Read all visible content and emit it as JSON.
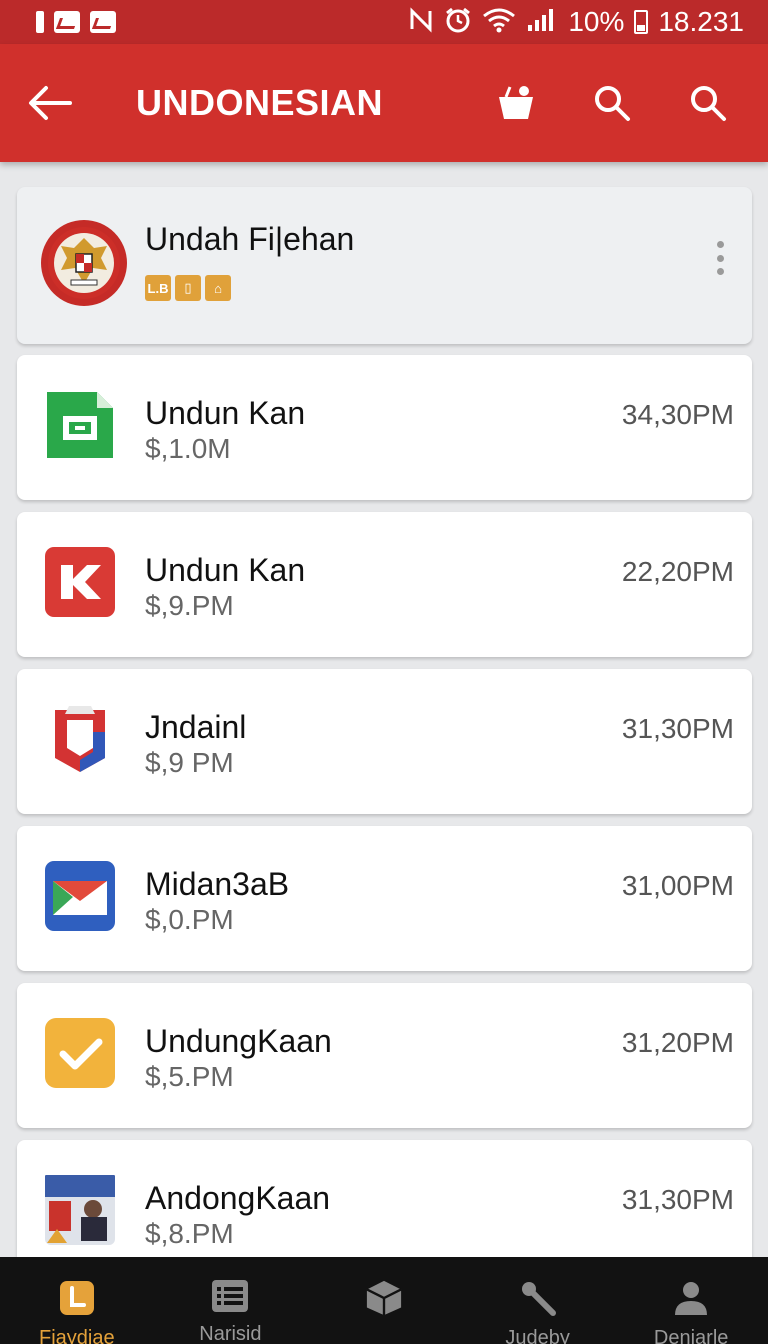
{
  "status_bar": {
    "battery": "10%",
    "time": "18.231"
  },
  "app_bar": {
    "title": "UNDONESIAN"
  },
  "header_card": {
    "title": "Undah Fi|ehan",
    "badges": [
      "L.B",
      "",
      ""
    ]
  },
  "items": [
    {
      "title": "Undun Kan",
      "subtitle": "$,1.0M",
      "time": "34,30PM",
      "icon": "green-document-icon",
      "color": "#2aa84a"
    },
    {
      "title": "Undun Kan",
      "subtitle": "$,9.PM",
      "time": "22,20PM",
      "icon": "red-k-icon",
      "color": "#d93a35"
    },
    {
      "title": "Jndainl",
      "subtitle": "$,9 PM",
      "time": "31,30PM",
      "icon": "red-blue-shield-icon",
      "color": "#d33333"
    },
    {
      "title": "Midan3aB",
      "subtitle": "$,0.PM",
      "time": "31,00PM",
      "icon": "blue-mail-icon",
      "color": "#2f5fbf"
    },
    {
      "title": "UndungKaan",
      "subtitle": "$,5.PM",
      "time": "31,20PM",
      "icon": "yellow-check-icon",
      "color": "#f2b33c"
    },
    {
      "title": "AndongKaan",
      "subtitle": "$,8.PM",
      "time": "31,30PM",
      "icon": "photo-thumbnail-icon",
      "color": "#3a5ca8"
    }
  ],
  "bottom_nav": [
    {
      "label": "Fiaydiae",
      "icon": "phone-icon",
      "active": true
    },
    {
      "label": "Narisid",
      "icon": "list-icon",
      "active": false
    },
    {
      "label": "",
      "icon": "box-icon",
      "active": false
    },
    {
      "label": "Judeby",
      "icon": "wrench-icon",
      "active": false
    },
    {
      "label": "Denjarle",
      "icon": "person-icon",
      "active": false
    }
  ]
}
